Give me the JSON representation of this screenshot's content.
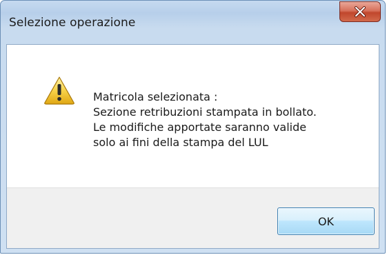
{
  "window": {
    "title": "Selezione operazione",
    "close_icon": "close-x-icon"
  },
  "message": {
    "icon": "warning-icon",
    "lines": [
      "Matricola selezionata :",
      "Sezione retribuzioni stampata in bollato.",
      "Le modifiche apportate saranno valide",
      "solo ai fini della stampa del LUL"
    ]
  },
  "buttons": {
    "ok_label": "OK"
  },
  "colors": {
    "titlebar": "#c6daf0",
    "close_button": "#c0462c",
    "ok_button_border": "#3c7fb1"
  }
}
